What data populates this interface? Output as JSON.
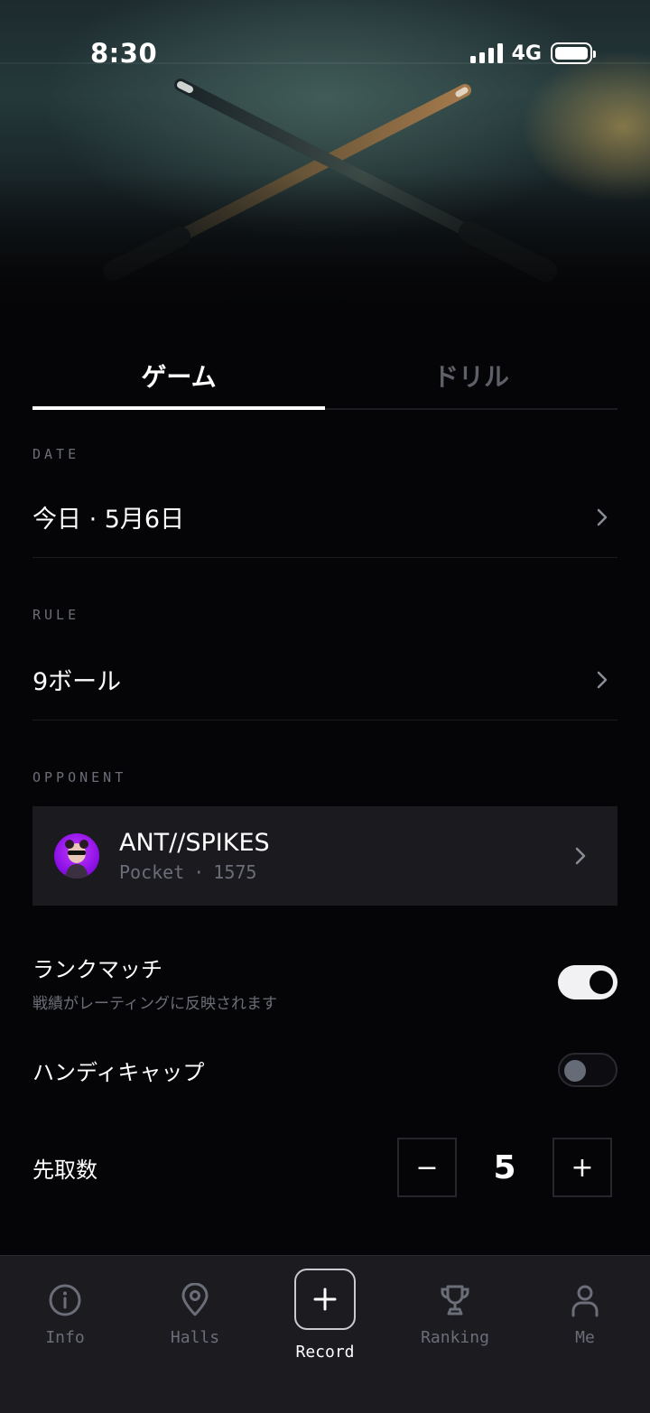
{
  "status_bar": {
    "time": "8:30",
    "network": "4G"
  },
  "tabs": [
    {
      "label": "ゲーム",
      "active": true
    },
    {
      "label": "ドリル",
      "active": false
    }
  ],
  "date": {
    "label": "DATE",
    "value": "今日 · 5月6日"
  },
  "rule": {
    "label": "RULE",
    "value": "9ボール"
  },
  "opponent": {
    "label": "OPPONENT",
    "name": "ANT//SPIKES",
    "type": "Pocket",
    "separator": "·",
    "rating": "1575"
  },
  "ranked_match": {
    "title": "ランクマッチ",
    "subtitle": "戦績がレーティングに反映されます",
    "enabled": true
  },
  "handicap": {
    "title": "ハンディキャップ",
    "enabled": false
  },
  "race_to": {
    "title": "先取数",
    "value": "5",
    "minus": "−",
    "plus": "+"
  },
  "bottom_nav": [
    {
      "label": "Info",
      "icon": "info-icon",
      "active": false
    },
    {
      "label": "Halls",
      "icon": "location-pin-icon",
      "active": false
    },
    {
      "label": "Record",
      "icon": "plus-icon",
      "active": true
    },
    {
      "label": "Ranking",
      "icon": "trophy-icon",
      "active": false
    },
    {
      "label": "Me",
      "icon": "person-icon",
      "active": false
    }
  ],
  "colors": {
    "background": "#050507",
    "card": "#1a1a1f",
    "muted_text": "#6b6e78",
    "avatar": "#8f12e6"
  }
}
